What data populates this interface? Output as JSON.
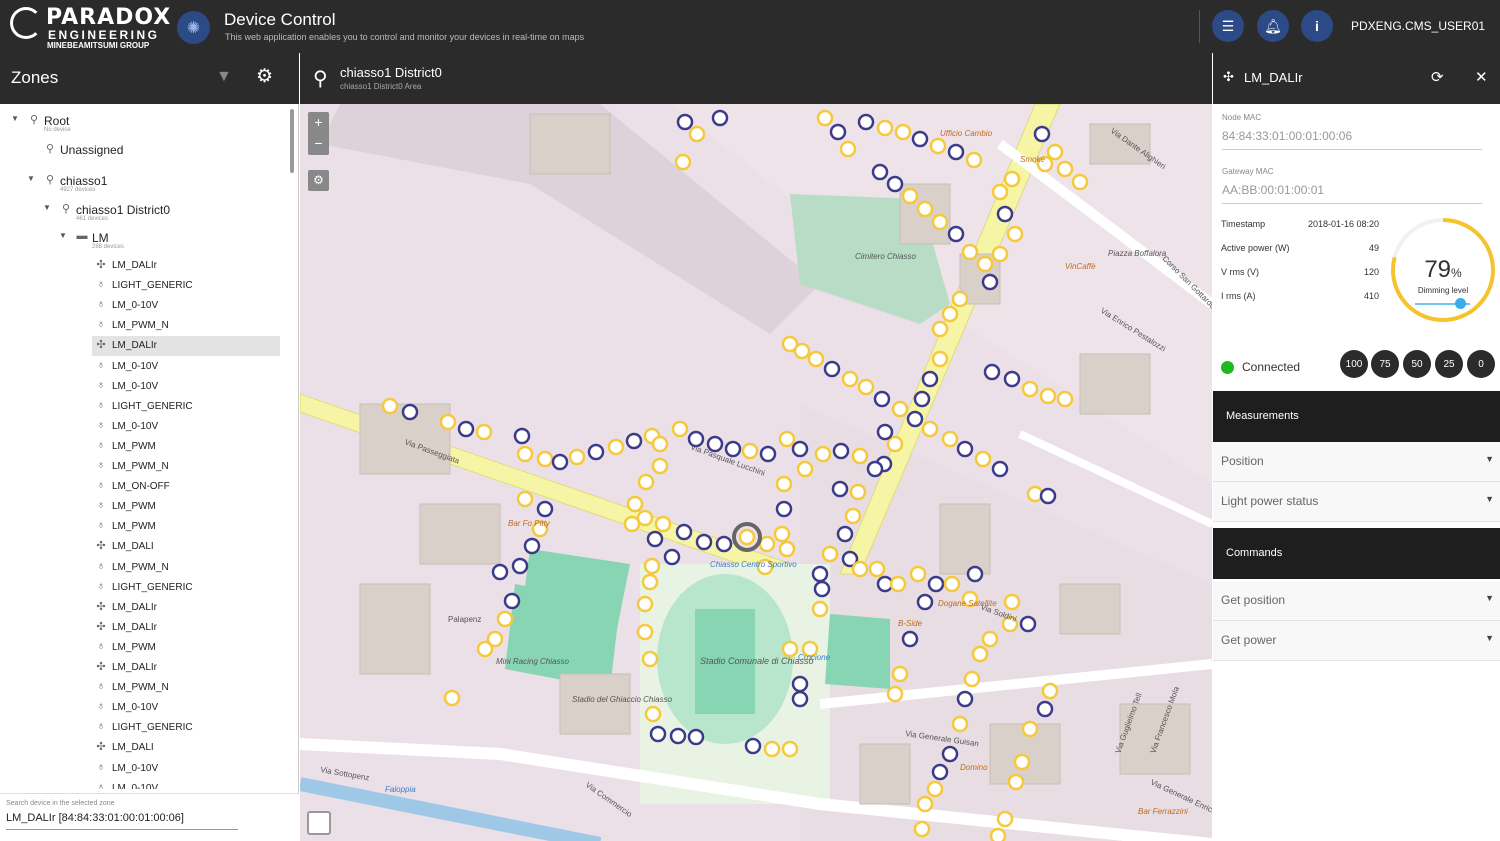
{
  "brand": {
    "line1": "PARADOX",
    "line2": "ENGINEERING",
    "line3": "MINEBEAMITSUMI GROUP"
  },
  "app": {
    "title": "Device Control",
    "subtitle": "This web application enables you to control and monitor your devices in real-time on maps",
    "user": "PDXENG.CMS_USER01",
    "icons": [
      "menu-icon",
      "bell-icon",
      "info-icon"
    ]
  },
  "zones": {
    "title": "Zones",
    "tree": [
      {
        "label": "Root",
        "sub": "No device",
        "level": 0,
        "type": "pin"
      },
      {
        "label": "Unassigned",
        "sub": "",
        "level": 1,
        "type": "pin"
      },
      {
        "label": "chiasso1",
        "sub": "4927 devices",
        "level": 1,
        "type": "pin"
      },
      {
        "label": "chiasso1 District0",
        "sub": "461 devices",
        "level": 2,
        "type": "pin"
      },
      {
        "label": "LM",
        "sub": "288 devices",
        "level": 3,
        "type": "folder"
      }
    ],
    "devices": [
      {
        "label": "LM_DALIr",
        "icon": "dali"
      },
      {
        "label": "LIGHT_GENERIC",
        "icon": "bulb"
      },
      {
        "label": "LM_0-10V",
        "icon": "bulb"
      },
      {
        "label": "LM_PWM_N",
        "icon": "bulb"
      },
      {
        "label": "LM_DALIr",
        "icon": "dali",
        "selected": true
      },
      {
        "label": "LM_0-10V",
        "icon": "bulb"
      },
      {
        "label": "LM_0-10V",
        "icon": "bulb"
      },
      {
        "label": "LIGHT_GENERIC",
        "icon": "bulb"
      },
      {
        "label": "LM_0-10V",
        "icon": "bulb"
      },
      {
        "label": "LM_PWM",
        "icon": "bulb"
      },
      {
        "label": "LM_PWM_N",
        "icon": "bulb"
      },
      {
        "label": "LM_ON-OFF",
        "icon": "bulb"
      },
      {
        "label": "LM_PWM",
        "icon": "bulb"
      },
      {
        "label": "LM_PWM",
        "icon": "bulb"
      },
      {
        "label": "LM_DALI",
        "icon": "dali"
      },
      {
        "label": "LM_PWM_N",
        "icon": "bulb"
      },
      {
        "label": "LIGHT_GENERIC",
        "icon": "bulb"
      },
      {
        "label": "LM_DALIr",
        "icon": "dali"
      },
      {
        "label": "LM_DALIr",
        "icon": "dali"
      },
      {
        "label": "LM_PWM",
        "icon": "bulb"
      },
      {
        "label": "LM_DALIr",
        "icon": "dali"
      },
      {
        "label": "LM_PWM_N",
        "icon": "bulb"
      },
      {
        "label": "LM_0-10V",
        "icon": "bulb"
      },
      {
        "label": "LIGHT_GENERIC",
        "icon": "bulb"
      },
      {
        "label": "LM_DALI",
        "icon": "dali"
      },
      {
        "label": "LM_0-10V",
        "icon": "bulb"
      },
      {
        "label": "LM_0-10V",
        "icon": "bulb"
      }
    ],
    "search_label": "Search device in the selected zone",
    "search_value": "LM_DALIr [84:84:33:01:00:01:00:06]"
  },
  "map": {
    "title": "chiasso1 District0",
    "subtitle": "chiasso1 District0 Area",
    "zoom_in": "+",
    "zoom_out": "−",
    "places": [
      "Cimitero Chiasso",
      "Piazza Boffalora",
      "Stadio Comunale di Chiasso",
      "Stadio del Ghiaccio Chiasso",
      "Palapenz",
      "Mini Racing Chiasso",
      "Chiasso Centro Sportivo",
      "Via Passeggiata",
      "Via Pasquale Lucchini",
      "Via Generale Guisan",
      "Via Soldini",
      "Via Commercio",
      "Via Sottopenz",
      "Via Dante Alighieri",
      "Via Enrico Pestalozzi",
      "Corso San Gottardo",
      "Via Guglielmo Tell",
      "Via Francesco Mola",
      "Via Generale Enrico Guisan",
      "Faloppia",
      "Ufficio Cambio",
      "VinCaffè",
      "Dogane Satellite",
      "Bar Ferrazzini",
      "B-Side",
      "Crocione",
      "Domino",
      "Bar Fo Pitty",
      "Smoke"
    ]
  },
  "device": {
    "title": "LM_DALIr",
    "node_mac_label": "Node MAC",
    "node_mac": "84:84:33:01:00:01:00:06",
    "gateway_mac_label": "Gateway MAC",
    "gateway_mac": "AA:BB:00:01:00:01",
    "measurements": [
      {
        "label": "Timestamp",
        "value": "2018-01-16 08:20"
      },
      {
        "label": "Active power (W)",
        "value": "49"
      },
      {
        "label": "V rms (V)",
        "value": "120"
      },
      {
        "label": "I rms (A)",
        "value": "410"
      }
    ],
    "dimming": {
      "value": "79",
      "unit": "%",
      "label": "Dimming level",
      "level": 0.79
    },
    "status": "Connected",
    "status_color": "#1fb81f",
    "dim_buttons": [
      "100",
      "75",
      "50",
      "25",
      "0"
    ],
    "sections": {
      "measurements": "Measurements",
      "position": "Position",
      "light_power": "Light power status",
      "commands": "Commands",
      "get_position": "Get position",
      "get_power": "Get power"
    }
  }
}
